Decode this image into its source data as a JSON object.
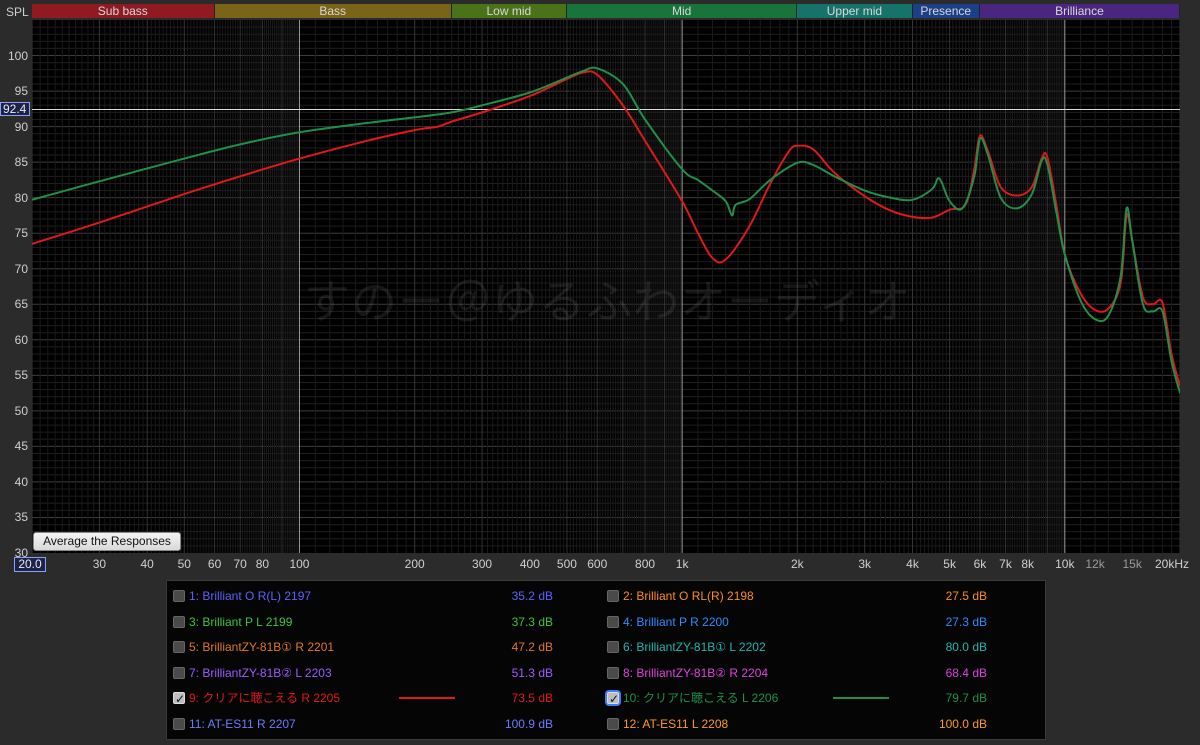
{
  "axis": {
    "y_label": "SPL",
    "y_ticks": [
      "100",
      "95",
      "90",
      "85",
      "80",
      "75",
      "70",
      "65",
      "60",
      "55",
      "50",
      "45",
      "40",
      "35",
      "30"
    ],
    "x_ticks": [
      "30",
      "40",
      "50",
      "60",
      "70",
      "80",
      "100",
      "200",
      "300",
      "400",
      "500",
      "600",
      "800",
      "1k",
      "2k",
      "3k",
      "4k",
      "5k",
      "6k",
      "7k",
      "8k",
      "10k",
      "12k",
      "15k",
      "20kHz"
    ]
  },
  "cursor": {
    "y_value": "92.4",
    "x_value": "20.0"
  },
  "bands": [
    {
      "label": "Sub bass",
      "color": "#8f1a22"
    },
    {
      "label": "Bass",
      "color": "#7a6418"
    },
    {
      "label": "Low mid",
      "color": "#4a7218"
    },
    {
      "label": "Mid",
      "color": "#18743a"
    },
    {
      "label": "Upper mid",
      "color": "#17736a"
    },
    {
      "label": "Presence",
      "color": "#1c3f8a"
    },
    {
      "label": "Brilliance",
      "color": "#4b2680"
    }
  ],
  "button": {
    "average_label": "Average the Responses"
  },
  "watermark": "すのー＠ゆるふわオーディオ",
  "legend": [
    {
      "label": "1: Brilliant O R(L) 2197",
      "value": "35.2 dB",
      "color": "#5f5fff",
      "checked": false
    },
    {
      "label": "2: Brilliant O RL(R)  2198",
      "value": "27.5 dB",
      "color": "#ff8c1a",
      "checked": false
    },
    {
      "label": "3: Brilliant P L 2199",
      "value": "37.3 dB",
      "color": "#3ec43e",
      "checked": false
    },
    {
      "label": "4: Brilliant P R 2200",
      "value": "27.3 dB",
      "color": "#2e8cff",
      "checked": false
    },
    {
      "label": "5: BrilliantZY-81B①  R 2201",
      "value": "47.2 dB",
      "color": "#e07820",
      "checked": false
    },
    {
      "label": "6: BrilliantZY-81B①  L 2202",
      "value": "80.0 dB",
      "color": "#1fb5b0",
      "checked": false
    },
    {
      "label": "7: BrilliantZY-81B②  L 2203",
      "value": "51.3 dB",
      "color": "#9a5cff",
      "checked": false
    },
    {
      "label": "8: BrilliantZY-81B②  R 2204",
      "value": "68.4 dB",
      "color": "#e040e0",
      "checked": false
    },
    {
      "label": "9: クリアに聴こえる  R 2205",
      "value": "73.5 dB",
      "color": "#e01818",
      "checked": true
    },
    {
      "label": "10: クリアに聴こえる  L 2206",
      "value": "79.7 dB",
      "color": "#1f8f4a",
      "checked": true
    },
    {
      "label": "11: AT-ES11  R 2207",
      "value": "100.9 dB",
      "color": "#6a7cff",
      "checked": false
    },
    {
      "label": "12: AT-ES11  L 2208",
      "value": "100.0 dB",
      "color": "#ff9a1a",
      "checked": false
    }
  ],
  "chart_data": {
    "type": "line",
    "title": "",
    "xlabel": "",
    "ylabel": "SPL",
    "x_scale": "log",
    "xlim": [
      20,
      20000
    ],
    "ylim": [
      30,
      105
    ],
    "grid": true,
    "series": [
      {
        "name": "9: クリアに聴こえる  R 2205",
        "color": "#e01818",
        "points": [
          [
            20,
            73.5
          ],
          [
            30,
            76.5
          ],
          [
            50,
            80.5
          ],
          [
            70,
            83
          ],
          [
            100,
            85.5
          ],
          [
            150,
            88
          ],
          [
            200,
            89.5
          ],
          [
            230,
            90
          ],
          [
            250,
            90.7
          ],
          [
            300,
            92
          ],
          [
            400,
            94.3
          ],
          [
            500,
            96.7
          ],
          [
            550,
            97.6
          ],
          [
            600,
            97.3
          ],
          [
            700,
            93
          ],
          [
            800,
            88
          ],
          [
            1000,
            79.5
          ],
          [
            1100,
            75
          ],
          [
            1200,
            71.5
          ],
          [
            1300,
            71.3
          ],
          [
            1500,
            76
          ],
          [
            1700,
            82
          ],
          [
            1900,
            86.5
          ],
          [
            2000,
            87.3
          ],
          [
            2200,
            86.8
          ],
          [
            2500,
            83.5
          ],
          [
            3000,
            80.2
          ],
          [
            3500,
            78.2
          ],
          [
            4000,
            77.3
          ],
          [
            4500,
            77.2
          ],
          [
            5000,
            78.3
          ],
          [
            5500,
            79
          ],
          [
            5800,
            84
          ],
          [
            6000,
            88.7
          ],
          [
            6300,
            86.5
          ],
          [
            6800,
            81.5
          ],
          [
            7500,
            80.3
          ],
          [
            8200,
            81.5
          ],
          [
            8700,
            85.5
          ],
          [
            9000,
            85.7
          ],
          [
            9500,
            79
          ],
          [
            10000,
            72
          ],
          [
            11000,
            66.5
          ],
          [
            12000,
            64.2
          ],
          [
            13000,
            64.4
          ],
          [
            14000,
            68
          ],
          [
            14500,
            77.5
          ],
          [
            15000,
            74
          ],
          [
            16000,
            66
          ],
          [
            17000,
            65
          ],
          [
            18000,
            65.2
          ],
          [
            19000,
            58
          ],
          [
            20000,
            53.5
          ]
        ]
      },
      {
        "name": "10: クリアに聴こえる  L 2206",
        "color": "#1f8f4a",
        "points": [
          [
            20,
            79.7
          ],
          [
            30,
            82.3
          ],
          [
            50,
            85.5
          ],
          [
            70,
            87.5
          ],
          [
            100,
            89.2
          ],
          [
            150,
            90.5
          ],
          [
            200,
            91.3
          ],
          [
            250,
            92
          ],
          [
            300,
            93
          ],
          [
            400,
            94.8
          ],
          [
            500,
            96.9
          ],
          [
            550,
            97.8
          ],
          [
            600,
            98.2
          ],
          [
            700,
            96
          ],
          [
            800,
            91
          ],
          [
            1000,
            84
          ],
          [
            1100,
            82.5
          ],
          [
            1200,
            81
          ],
          [
            1300,
            79.5
          ],
          [
            1350,
            77.5
          ],
          [
            1380,
            79
          ],
          [
            1500,
            79.8
          ],
          [
            1700,
            82.5
          ],
          [
            2000,
            84.9
          ],
          [
            2200,
            84.6
          ],
          [
            2500,
            83
          ],
          [
            3000,
            81
          ],
          [
            3500,
            80
          ],
          [
            4000,
            79.7
          ],
          [
            4500,
            81.2
          ],
          [
            4700,
            82.7
          ],
          [
            5000,
            79.5
          ],
          [
            5400,
            78.5
          ],
          [
            5800,
            83
          ],
          [
            6000,
            88.3
          ],
          [
            6300,
            86
          ],
          [
            6800,
            80
          ],
          [
            7500,
            78.5
          ],
          [
            8200,
            80.5
          ],
          [
            8700,
            85.2
          ],
          [
            9000,
            84.7
          ],
          [
            9500,
            78
          ],
          [
            10000,
            72
          ],
          [
            11000,
            65.5
          ],
          [
            12000,
            62.9
          ],
          [
            13000,
            63.4
          ],
          [
            14000,
            69
          ],
          [
            14500,
            78.5
          ],
          [
            15000,
            74
          ],
          [
            16000,
            65
          ],
          [
            17000,
            64
          ],
          [
            18000,
            64
          ],
          [
            19000,
            57
          ],
          [
            20000,
            52.5
          ]
        ]
      }
    ]
  }
}
